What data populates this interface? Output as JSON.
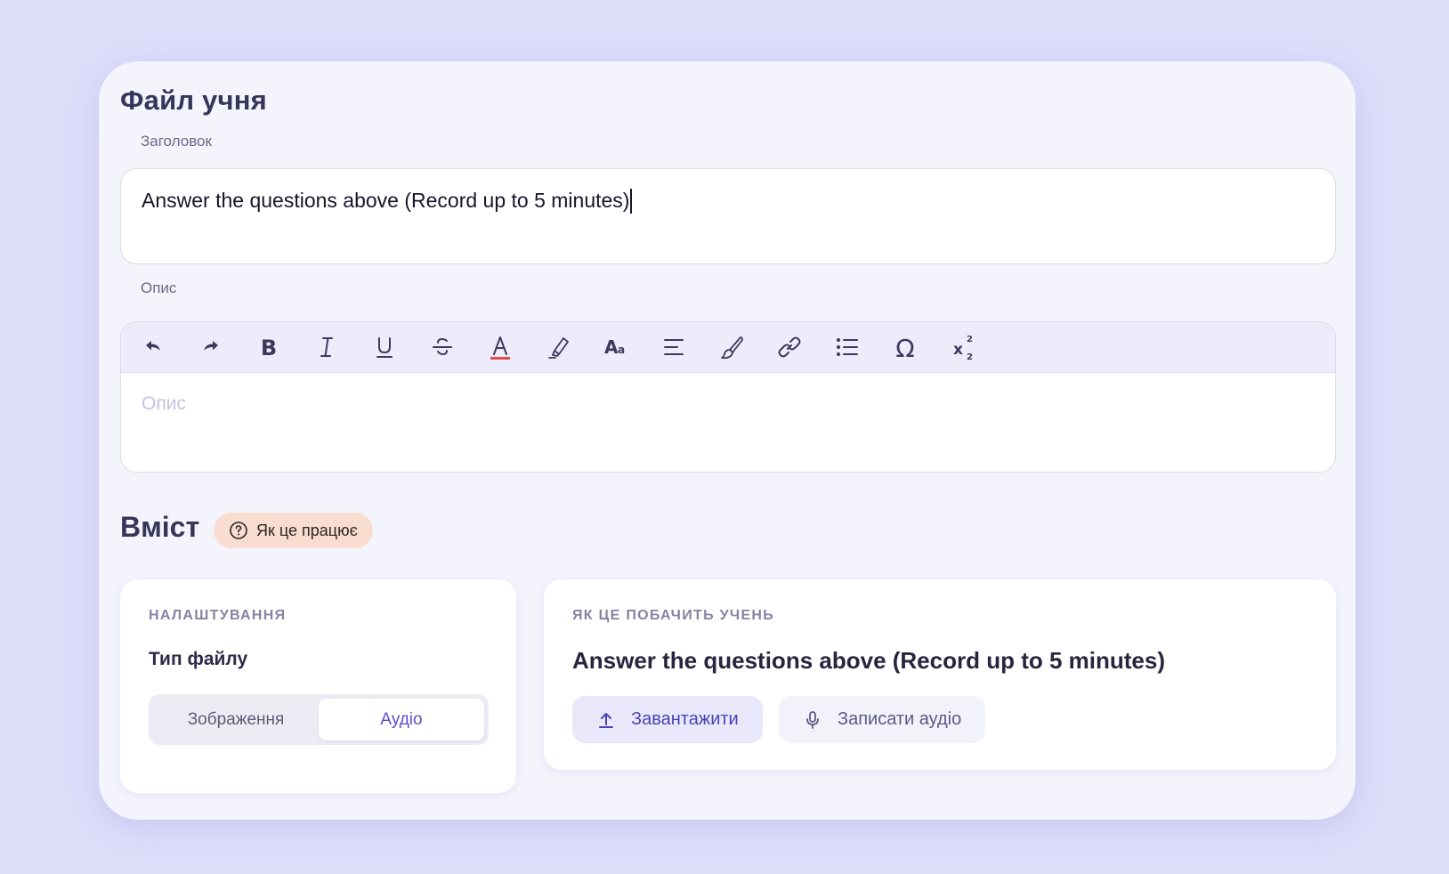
{
  "page": {
    "title": "Файл учня"
  },
  "title_field": {
    "label": "Заголовок",
    "value": "Answer the questions above (Record up to 5 minutes)"
  },
  "description_field": {
    "label": "Опис",
    "placeholder": "Опис",
    "toolbar": [
      {
        "name": "undo-icon",
        "tooltip": "undo"
      },
      {
        "name": "redo-icon",
        "tooltip": "redo"
      },
      {
        "name": "bold-icon",
        "tooltip": "bold"
      },
      {
        "name": "italic-icon",
        "tooltip": "italic"
      },
      {
        "name": "underline-icon",
        "tooltip": "underline"
      },
      {
        "name": "strikethrough-icon",
        "tooltip": "strikethrough"
      },
      {
        "name": "text-color-icon",
        "tooltip": "text color"
      },
      {
        "name": "highlighter-icon",
        "tooltip": "highlight"
      },
      {
        "name": "font-size-icon",
        "tooltip": "font size"
      },
      {
        "name": "align-icon",
        "tooltip": "align"
      },
      {
        "name": "brush-icon",
        "tooltip": "format painter"
      },
      {
        "name": "link-icon",
        "tooltip": "link"
      },
      {
        "name": "bullet-list-icon",
        "tooltip": "bullet list"
      },
      {
        "name": "omega-icon",
        "tooltip": "special characters"
      },
      {
        "name": "superscript-subscript-icon",
        "tooltip": "superscript/subscript"
      }
    ]
  },
  "content_section": {
    "title": "Вміст",
    "help_label": "Як це працює"
  },
  "settings_panel": {
    "caption": "НАЛАШТУВАННЯ",
    "file_type_label": "Тип файлу",
    "options": [
      "Зображення",
      "Аудіо"
    ],
    "selected": "Аудіо"
  },
  "preview_panel": {
    "caption": "ЯК ЦЕ ПОБАЧИТЬ УЧЕНЬ",
    "title": "Answer the questions above (Record up to 5 minutes)",
    "upload_label": "Завантажити",
    "record_label": "Записати аудіо"
  },
  "colors": {
    "background": "#dedefb",
    "accent": "#5a4fce",
    "help_pill": "#f9ddd0",
    "text_color_underline": "#e5484d"
  }
}
